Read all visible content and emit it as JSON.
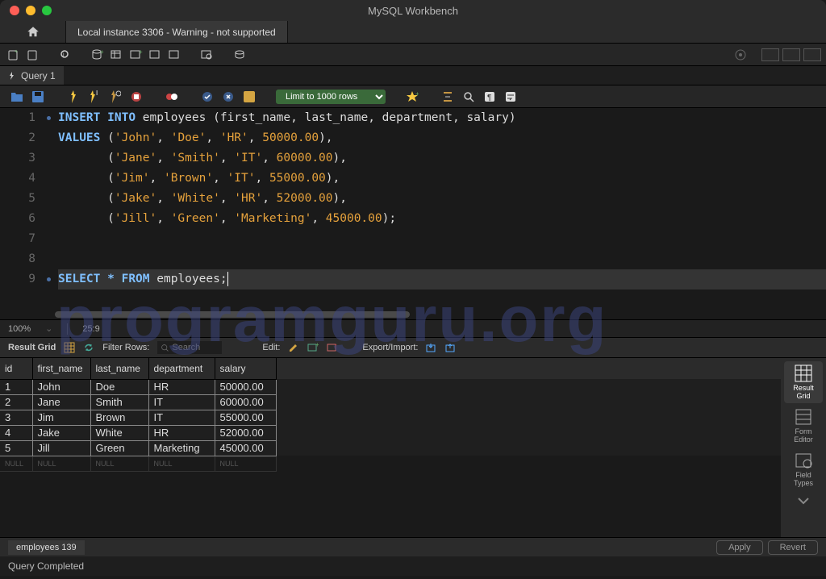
{
  "window": {
    "title": "MySQL Workbench"
  },
  "conn_tab": "Local instance 3306 - Warning - not supported",
  "query_tab": "Query 1",
  "limit": "Limit to 1000 rows",
  "zoom": "100%",
  "cursor": "25:9",
  "code": [
    {
      "n": 1,
      "dot": true,
      "tokens": [
        {
          "c": "kw",
          "t": "INSERT"
        },
        {
          "c": "punc",
          "t": " "
        },
        {
          "c": "kw",
          "t": "INTO"
        },
        {
          "c": "punc",
          "t": " "
        },
        {
          "c": "id",
          "t": "employees"
        },
        {
          "c": "punc",
          "t": " ("
        },
        {
          "c": "id",
          "t": "first_name"
        },
        {
          "c": "punc",
          "t": ", "
        },
        {
          "c": "id",
          "t": "last_name"
        },
        {
          "c": "punc",
          "t": ", "
        },
        {
          "c": "id",
          "t": "department"
        },
        {
          "c": "punc",
          "t": ", "
        },
        {
          "c": "id",
          "t": "salary"
        },
        {
          "c": "punc",
          "t": ")"
        }
      ]
    },
    {
      "n": 2,
      "dot": false,
      "tokens": [
        {
          "c": "kw",
          "t": "VALUES"
        },
        {
          "c": "punc",
          "t": " ("
        },
        {
          "c": "str",
          "t": "'John'"
        },
        {
          "c": "punc",
          "t": ", "
        },
        {
          "c": "str",
          "t": "'Doe'"
        },
        {
          "c": "punc",
          "t": ", "
        },
        {
          "c": "str",
          "t": "'HR'"
        },
        {
          "c": "punc",
          "t": ", "
        },
        {
          "c": "num",
          "t": "50000.00"
        },
        {
          "c": "punc",
          "t": "),"
        }
      ]
    },
    {
      "n": 3,
      "dot": false,
      "indent": "       ",
      "tokens": [
        {
          "c": "punc",
          "t": "("
        },
        {
          "c": "str",
          "t": "'Jane'"
        },
        {
          "c": "punc",
          "t": ", "
        },
        {
          "c": "str",
          "t": "'Smith'"
        },
        {
          "c": "punc",
          "t": ", "
        },
        {
          "c": "str",
          "t": "'IT'"
        },
        {
          "c": "punc",
          "t": ", "
        },
        {
          "c": "num",
          "t": "60000.00"
        },
        {
          "c": "punc",
          "t": "),"
        }
      ]
    },
    {
      "n": 4,
      "dot": false,
      "indent": "       ",
      "tokens": [
        {
          "c": "punc",
          "t": "("
        },
        {
          "c": "str",
          "t": "'Jim'"
        },
        {
          "c": "punc",
          "t": ", "
        },
        {
          "c": "str",
          "t": "'Brown'"
        },
        {
          "c": "punc",
          "t": ", "
        },
        {
          "c": "str",
          "t": "'IT'"
        },
        {
          "c": "punc",
          "t": ", "
        },
        {
          "c": "num",
          "t": "55000.00"
        },
        {
          "c": "punc",
          "t": "),"
        }
      ]
    },
    {
      "n": 5,
      "dot": false,
      "indent": "       ",
      "tokens": [
        {
          "c": "punc",
          "t": "("
        },
        {
          "c": "str",
          "t": "'Jake'"
        },
        {
          "c": "punc",
          "t": ", "
        },
        {
          "c": "str",
          "t": "'White'"
        },
        {
          "c": "punc",
          "t": ", "
        },
        {
          "c": "str",
          "t": "'HR'"
        },
        {
          "c": "punc",
          "t": ", "
        },
        {
          "c": "num",
          "t": "52000.00"
        },
        {
          "c": "punc",
          "t": "),"
        }
      ]
    },
    {
      "n": 6,
      "dot": false,
      "indent": "       ",
      "tokens": [
        {
          "c": "punc",
          "t": "("
        },
        {
          "c": "str",
          "t": "'Jill'"
        },
        {
          "c": "punc",
          "t": ", "
        },
        {
          "c": "str",
          "t": "'Green'"
        },
        {
          "c": "punc",
          "t": ", "
        },
        {
          "c": "str",
          "t": "'Marketing'"
        },
        {
          "c": "punc",
          "t": ", "
        },
        {
          "c": "num",
          "t": "45000.00"
        },
        {
          "c": "punc",
          "t": ");"
        }
      ]
    },
    {
      "n": 7,
      "dot": false,
      "tokens": []
    },
    {
      "n": 8,
      "dot": false,
      "tokens": []
    },
    {
      "n": 9,
      "dot": true,
      "hl": true,
      "tokens": [
        {
          "c": "kw",
          "t": "SELECT"
        },
        {
          "c": "punc",
          "t": " "
        },
        {
          "c": "kw",
          "t": "*"
        },
        {
          "c": "punc",
          "t": " "
        },
        {
          "c": "kw",
          "t": "FROM"
        },
        {
          "c": "punc",
          "t": " "
        },
        {
          "c": "id",
          "t": "employees"
        },
        {
          "c": "punc",
          "t": ";"
        }
      ],
      "cursor": true
    }
  ],
  "resultbar": {
    "label": "Result Grid",
    "filter": "Filter Rows:",
    "filter_ph": "Search",
    "edit": "Edit:",
    "export": "Export/Import:"
  },
  "grid": {
    "cols": [
      "id",
      "first_name",
      "last_name",
      "department",
      "salary"
    ],
    "widths": [
      40,
      72,
      72,
      82,
      76
    ],
    "rows": [
      [
        "1",
        "John",
        "Doe",
        "HR",
        "50000.00"
      ],
      [
        "2",
        "Jane",
        "Smith",
        "IT",
        "60000.00"
      ],
      [
        "3",
        "Jim",
        "Brown",
        "IT",
        "55000.00"
      ],
      [
        "4",
        "Jake",
        "White",
        "HR",
        "52000.00"
      ],
      [
        "5",
        "Jill",
        "Green",
        "Marketing",
        "45000.00"
      ]
    ],
    "null_label": "NULL"
  },
  "sidepanel": [
    {
      "label": "Result\nGrid",
      "active": true
    },
    {
      "label": "Form\nEditor"
    },
    {
      "label": "Field\nTypes"
    }
  ],
  "result_tab": "employees 139",
  "apply": "Apply",
  "revert": "Revert",
  "status": "Query Completed",
  "watermark": "programguru.org"
}
